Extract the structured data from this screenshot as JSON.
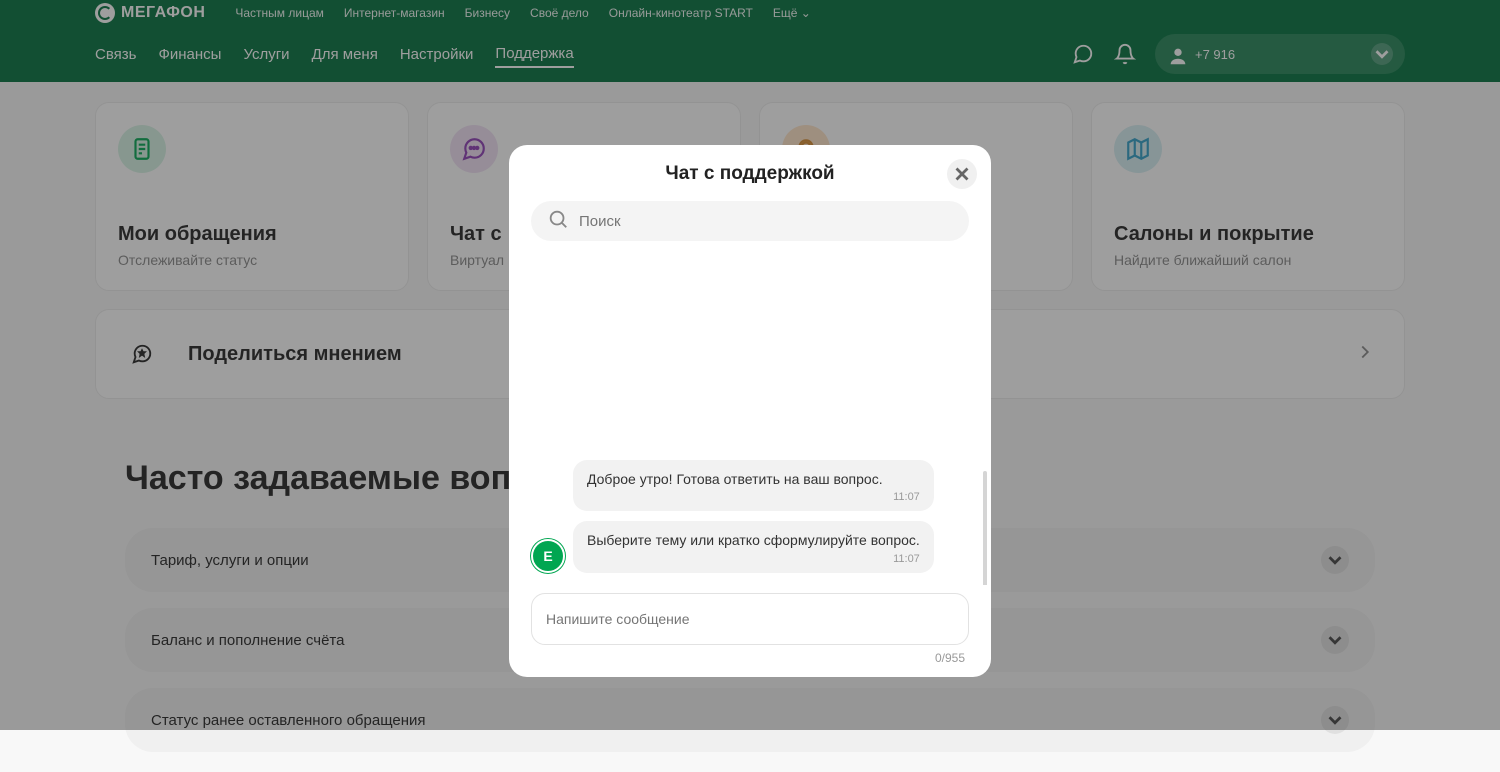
{
  "header": {
    "logo": "МЕГАФОН",
    "top_links": [
      "Частным лицам",
      "Интернет-магазин",
      "Бизнесу",
      "Своё дело",
      "Онлайн-кинотеатр START",
      "Ещё"
    ],
    "nav": [
      "Связь",
      "Финансы",
      "Услуги",
      "Для меня",
      "Настройки",
      "Поддержка"
    ],
    "active_nav_index": 5,
    "phone": "+7 916"
  },
  "cards": [
    {
      "title": "Мои обращения",
      "sub": "Отслеживайте статус",
      "icon": "document-icon",
      "color": "green"
    },
    {
      "title": "Чат с",
      "sub": "Виртуал",
      "icon": "chat-icon",
      "color": "purple"
    },
    {
      "title": "",
      "sub": "",
      "icon": "operator-icon",
      "color": "orange"
    },
    {
      "title": "Салоны и покрытие",
      "sub": "Найдите ближайший салон",
      "icon": "map-icon",
      "color": "teal"
    }
  ],
  "banner": {
    "title": "Поделиться мнением"
  },
  "faq": {
    "title": "Часто задаваемые вопро",
    "items": [
      "Тариф, услуги и опции",
      "Баланс и пополнение счёта",
      "Статус ранее оставленного обращения"
    ]
  },
  "modal": {
    "title": "Чат с поддержкой",
    "search_placeholder": "Поиск",
    "avatar_letter": "E",
    "messages": [
      {
        "text": "Доброе утро! Готова ответить на ваш вопрос.",
        "time": "11:07"
      },
      {
        "text": "Выберите тему или кратко сформулируйте вопрос.",
        "time": "11:07"
      }
    ],
    "input_placeholder": "Напишите сообщение",
    "counter": "0/955"
  }
}
